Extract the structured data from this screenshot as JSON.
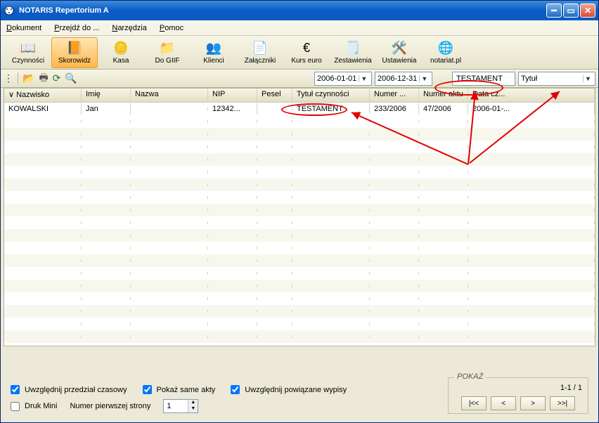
{
  "window": {
    "title": "NOTARIS Repertorium A"
  },
  "menu": {
    "dokument": "Dokument",
    "przejdz": "Przejdź do ...",
    "narzedzia": "Narzędzia",
    "pomoc": "Pomoc"
  },
  "toolbar": [
    {
      "id": "czynnosci",
      "label": "Czynności",
      "icon": "📖"
    },
    {
      "id": "skorowidz",
      "label": "Skorowidz",
      "icon": "📙",
      "active": true
    },
    {
      "id": "kasa",
      "label": "Kasa",
      "icon": "🪙"
    },
    {
      "id": "do-giif",
      "label": "Do GIIF",
      "icon": "📁"
    },
    {
      "id": "klienci",
      "label": "Klienci",
      "icon": "👥"
    },
    {
      "id": "zalaczniki",
      "label": "Załączniki",
      "icon": "📄"
    },
    {
      "id": "kurs-euro",
      "label": "Kurs euro",
      "icon": "€"
    },
    {
      "id": "zestawienia",
      "label": "Zestawienia",
      "icon": "🗒️"
    },
    {
      "id": "ustawienia",
      "label": "Ustawienia",
      "icon": "🛠️"
    },
    {
      "id": "notariat-pl",
      "label": "notariat.pl",
      "icon": "🌐"
    }
  ],
  "filter": {
    "date_from": "2006-01-01",
    "date_to": "2006-12-31",
    "search_value": "TESTAMENT",
    "search_field": "Tytuł"
  },
  "grid": {
    "columns": [
      "Nazwisko",
      "Imię",
      "Nazwa",
      "NIP",
      "Pesel",
      "Tytuł czynności",
      "Numer ...",
      "Numer aktu",
      "Data cz..."
    ],
    "sort_column": 0,
    "rows": [
      {
        "nazwisko": "KOWALSKI",
        "imie": "Jan",
        "nazwa": "",
        "nip": "12342...",
        "pesel": "",
        "tytul": "TESTAMENT",
        "numer": "233/2006",
        "numer_aktu": "47/2006",
        "data": "2006-01-..."
      }
    ]
  },
  "options": {
    "uwzglednij_przedzial": {
      "label": "Uwzględnij przedział czasowy",
      "checked": true
    },
    "pokaz_same_akty": {
      "label": "Pokaż same akty",
      "checked": true
    },
    "uwzglednij_wypisy": {
      "label": "Uwzględnij powiązane wypisy",
      "checked": true
    },
    "druk_mini": {
      "label": "Druk Mini",
      "checked": false
    },
    "numer_pierwszej": {
      "label": "Numer pierwszej strony",
      "value": "1"
    }
  },
  "pokaz": {
    "legend": "POKAŻ",
    "count": "1-1 / 1",
    "first": "|<<",
    "prev": "<",
    "next": ">",
    "last": ">>|"
  }
}
